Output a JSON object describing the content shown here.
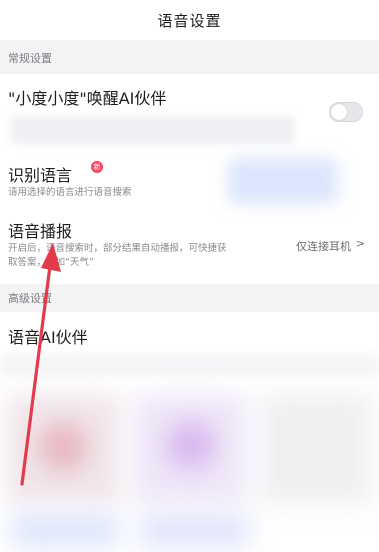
{
  "header": {
    "title": "语音设置"
  },
  "sections": {
    "general": "常规设置",
    "advanced": "高级设置"
  },
  "wake": {
    "title": "\"小度小度\"唤醒AI伙伴",
    "toggle_on": false
  },
  "recognition": {
    "title": "识别语言",
    "badge": "新",
    "subtitle": "请用选择的语言进行语音搜索"
  },
  "broadcast": {
    "title": "语音播报",
    "subtitle_line1": "开启后，语音搜索时，部分结果自动播报，可快捷获",
    "subtitle_line2": "取答案，例如“天气”",
    "value": "仅连接耳机",
    "chevron": ">"
  },
  "ai_partner": {
    "title": "语音AI伙伴"
  },
  "colors": {
    "annotation_arrow": "#e23b4b",
    "badge": "#f44a63"
  }
}
